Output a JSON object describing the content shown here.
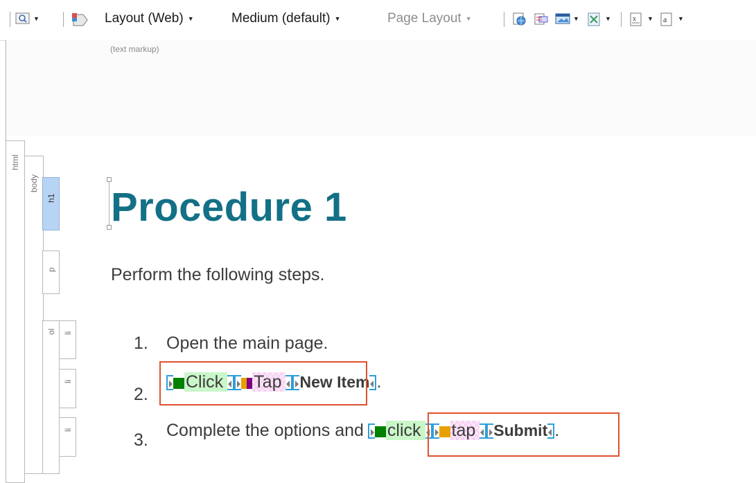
{
  "toolbar": {
    "layout": "Layout (Web)",
    "medium": "Medium (default)",
    "page_layout": "Page Layout"
  },
  "editor": {
    "markup_caption": "(text markup)"
  },
  "structure": {
    "html": "html",
    "body": "body",
    "h1": "h1",
    "p": "p",
    "ol": "ol",
    "li": "li"
  },
  "document": {
    "title": "Procedure 1",
    "intro": "Perform the following steps.",
    "steps": [
      {
        "number": "1.",
        "text": "Open the main page."
      },
      {
        "number": "2.",
        "click": "Click",
        "tap": "Tap",
        "target": "New Item",
        "end": "."
      },
      {
        "number": "3.",
        "text": "Complete the options and",
        "click": "click",
        "tap": "tap",
        "target": "Submit",
        "end": "."
      }
    ]
  },
  "colors": {
    "heading": "#137086",
    "click_condition": "#008000",
    "tap_condition_step2": "#e8a000",
    "tap_condition_mark2": "#800080",
    "tap_condition_step3": "#e8a000",
    "highlight_box": "#e0502e",
    "tag_marker": "#2d9fd9"
  }
}
